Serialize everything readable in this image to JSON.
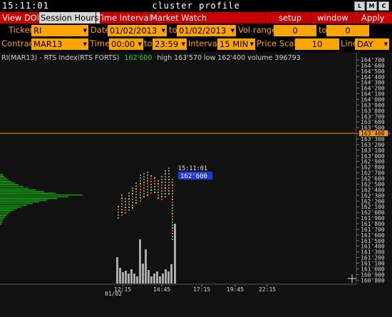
{
  "window": {
    "clock": "15:11:01",
    "title": "cluster profile",
    "buttons": [
      "L",
      "M",
      "C"
    ]
  },
  "menu": {
    "items": [
      "View DOM",
      "Session Hours",
      "Time Interval",
      "Market Watch"
    ],
    "selected": "Session Hours",
    "right_items": [
      "setup",
      "window",
      "Apply"
    ]
  },
  "form": {
    "ticker_label": "Ticker",
    "ticker_value": "RI",
    "date_label": "Date",
    "date_from": "01/02/2013",
    "to_label": "to",
    "date_to": "01/02/2013",
    "volrange_label": "Vol range",
    "vol_from": "0",
    "vol_to_label": "to",
    "vol_to": "0",
    "contract_label": "Contract",
    "contract_value": "MAR13",
    "time_label": "Time",
    "time_from": "00:00",
    "time_to_label": "to",
    "time_to": "23:59",
    "interval_label": "Interval",
    "interval_value": "15 MIN",
    "pricescale_label": "Price Scale",
    "pricescale_value": "10",
    "line_label": "Line",
    "line_value": "DAY"
  },
  "chart_header": {
    "symbol": "RI(MAR13) - RTS Index(RTS FORTS)",
    "last": "162'600",
    "high": "high 163'570",
    "low": "low 162'400",
    "volume": "volume 396793"
  },
  "cursor_label": {
    "time": "15:11:01",
    "price": "162'600"
  },
  "price_axis": {
    "ticks": [
      "164'700",
      "164'600",
      "164'500",
      "164'400",
      "164'300",
      "164'200",
      "164'100",
      "164'000",
      "163'900",
      "163'800",
      "163'700",
      "163'600",
      "163'500",
      "163'400",
      "163'300",
      "163'200",
      "163'100",
      "163'000",
      "162'900",
      "162'800",
      "162'700",
      "162'600",
      "162'500",
      "162'400",
      "162'300",
      "162'200",
      "162'100",
      "162'000",
      "161'900",
      "161'800",
      "161'700",
      "161'600",
      "161'500",
      "161'400",
      "161'300",
      "161'200",
      "161'100",
      "161'000",
      "160'900",
      "160'800"
    ],
    "marker": "163'400"
  },
  "time_axis": {
    "date_label": "01/02",
    "ticks": [
      "12:15",
      "14:45",
      "17:15",
      "19:45",
      "22:15"
    ]
  },
  "colors": {
    "menu_bg": "#c80000",
    "field_bg": "#ffa400",
    "profile_green": "#00c800",
    "line_orange": "#ff9900",
    "cursor_blue": "#1e3cdc"
  }
}
